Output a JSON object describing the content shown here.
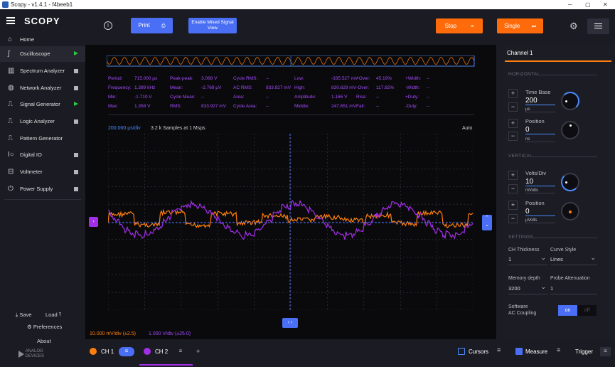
{
  "window": {
    "title": "Scopy - v1.4.1 - f4beeb1",
    "minimize": "─",
    "maximize": "▢",
    "close": "✕"
  },
  "sidebar": {
    "logo": "SCOPY",
    "home": "Home",
    "items": [
      {
        "label": "Oscilloscope",
        "status": "running"
      },
      {
        "label": "Spectrum Analyzer",
        "status": "stopped"
      },
      {
        "label": "Network Analyzer",
        "status": "stopped"
      },
      {
        "label": "Signal Generator",
        "status": "running"
      },
      {
        "label": "Logic Analyzer",
        "status": "stopped"
      },
      {
        "label": "Pattern Generator",
        "status": "none"
      },
      {
        "label": "Digital IO",
        "status": "stopped"
      },
      {
        "label": "Voltmeter",
        "status": "stopped"
      },
      {
        "label": "Power Supply",
        "status": "stopped"
      }
    ],
    "save": "Save",
    "load": "Load",
    "preferences": "Preferences",
    "about": "About",
    "analog_logo": "ANALOG DEVICES"
  },
  "toolbar": {
    "print": "Print",
    "mixed": "Enable Mixed Signal View",
    "stop": "Stop",
    "single": "Single"
  },
  "plot": {
    "timebase_label": "200.000 µs/div",
    "samples": "3.2 k Samples at 1 Msps",
    "mode": "Auto",
    "ch1_scale": "10.000 mV/div (±2.5)",
    "ch2_scale": "1.000 V/div (±25.0)"
  },
  "measurements": [
    {
      "label": "Period:",
      "value": "715.000 µs"
    },
    {
      "label": "Peak-peak:",
      "value": "3.068 V"
    },
    {
      "label": "Cycle RMS:",
      "value": "--"
    },
    {
      "label": "Low:",
      "value": "-335.527 mV"
    },
    {
      "label": "+Over:",
      "value": "45.19%"
    },
    {
      "label": "+Width:",
      "value": "--"
    },
    {
      "label": "Frequency:",
      "value": "1.399 kHz"
    },
    {
      "label": "Mean:",
      "value": "-2.769 µV"
    },
    {
      "label": "AC RMS:",
      "value": "833.927 mV"
    },
    {
      "label": "High:",
      "value": "830.629 mV"
    },
    {
      "label": "-Over:",
      "value": "117.82%"
    },
    {
      "label": "-Width:",
      "value": "--"
    },
    {
      "label": "Min:",
      "value": "-1.710 V"
    },
    {
      "label": "Cycle Mean:",
      "value": "--"
    },
    {
      "label": "Area:",
      "value": "--"
    },
    {
      "label": "Amplitude:",
      "value": "1.166 V"
    },
    {
      "label": "Rise:",
      "value": "--"
    },
    {
      "label": "+Duty:",
      "value": "--"
    },
    {
      "label": "Max:",
      "value": "1.358 V"
    },
    {
      "label": "RMS:",
      "value": "833.927 mV"
    },
    {
      "label": "Cycle Area:",
      "value": "--"
    },
    {
      "label": "Middle:",
      "value": "247.651 mV"
    },
    {
      "label": "Fall:",
      "value": "--"
    },
    {
      "label": "-Duty:",
      "value": "--"
    }
  ],
  "panel": {
    "title": "Channel 1",
    "horizontal": "HORIZONTAL",
    "time_base_label": "Time Base",
    "time_base_value": "200",
    "time_base_unit": "µs",
    "h_position_label": "Position",
    "h_position_value": "0",
    "h_position_unit": "ns",
    "vertical": "VERTICAL",
    "volts_div_label": "Volts/Div",
    "volts_div_value": "10",
    "volts_div_unit": "mVolts",
    "v_position_label": "Position",
    "v_position_value": "0",
    "v_position_unit": "µVolts",
    "settings": "SETTINGS",
    "ch_thickness_label": "CH Thickness",
    "ch_thickness_value": "1",
    "curve_style_label": "Curve Style",
    "curve_style_value": "Lines",
    "memory_depth_label": "Memory depth",
    "memory_depth_value": "3200",
    "probe_att_label": "Probe Attenuation",
    "probe_att_value": "1",
    "software_label": "Software",
    "ac_coupling_label": "AC Coupling",
    "toggle_on": "on",
    "toggle_off": "off",
    "plus": "+",
    "minus": "−"
  },
  "bottom": {
    "ch1": "CH 1",
    "ch2": "CH 2",
    "add": "+",
    "cursors": "Cursors",
    "measure": "Measure",
    "trigger": "Trigger"
  },
  "colors": {
    "ch1": "#ff7f0e",
    "ch2": "#a22ee8",
    "accent": "#4a8cff",
    "stop": "#ff6b0a"
  }
}
